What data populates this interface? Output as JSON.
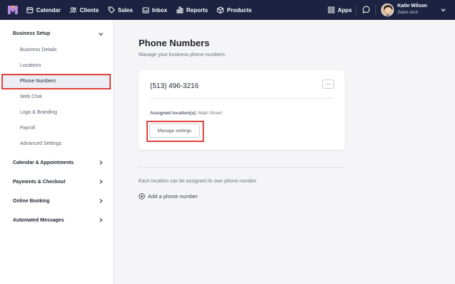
{
  "nav": {
    "items": [
      {
        "label": "Calendar",
        "icon": "calendar-icon"
      },
      {
        "label": "Clients",
        "icon": "clients-icon"
      },
      {
        "label": "Sales",
        "icon": "tag-icon"
      },
      {
        "label": "Inbox",
        "icon": "inbox-icon"
      },
      {
        "label": "Reports",
        "icon": "bar-chart-icon"
      },
      {
        "label": "Products",
        "icon": "box-icon"
      }
    ],
    "apps_label": "Apps",
    "user": {
      "name": "Katie Wilson",
      "subtitle": "Salon Azul"
    }
  },
  "sidebar": {
    "business_setup": {
      "label": "Business Setup",
      "items": [
        "Business Details",
        "Locations",
        "Phone Numbers",
        "Web Chat",
        "Logo & Branding",
        "Payroll",
        "Advanced Settings"
      ],
      "active": "Phone Numbers"
    },
    "sections": [
      "Calendar & Appointments",
      "Payments & Checkout",
      "Online Booking",
      "Automated Messages"
    ]
  },
  "main": {
    "title": "Phone Numbers",
    "subtitle": "Manage your business phone numbers.",
    "card": {
      "phone": "(513) 496-3216",
      "more_label": "···",
      "assigned_label": "Assigned location(s):",
      "assigned_value": "Main Street",
      "manage_label": "Manage settings"
    },
    "note": "Each location can be assigned its own phone number.",
    "add_label": "Add a phone number"
  },
  "colors": {
    "nav_bg": "#1b2340",
    "highlight": "#e0403a",
    "active_bg": "#eceef4"
  }
}
